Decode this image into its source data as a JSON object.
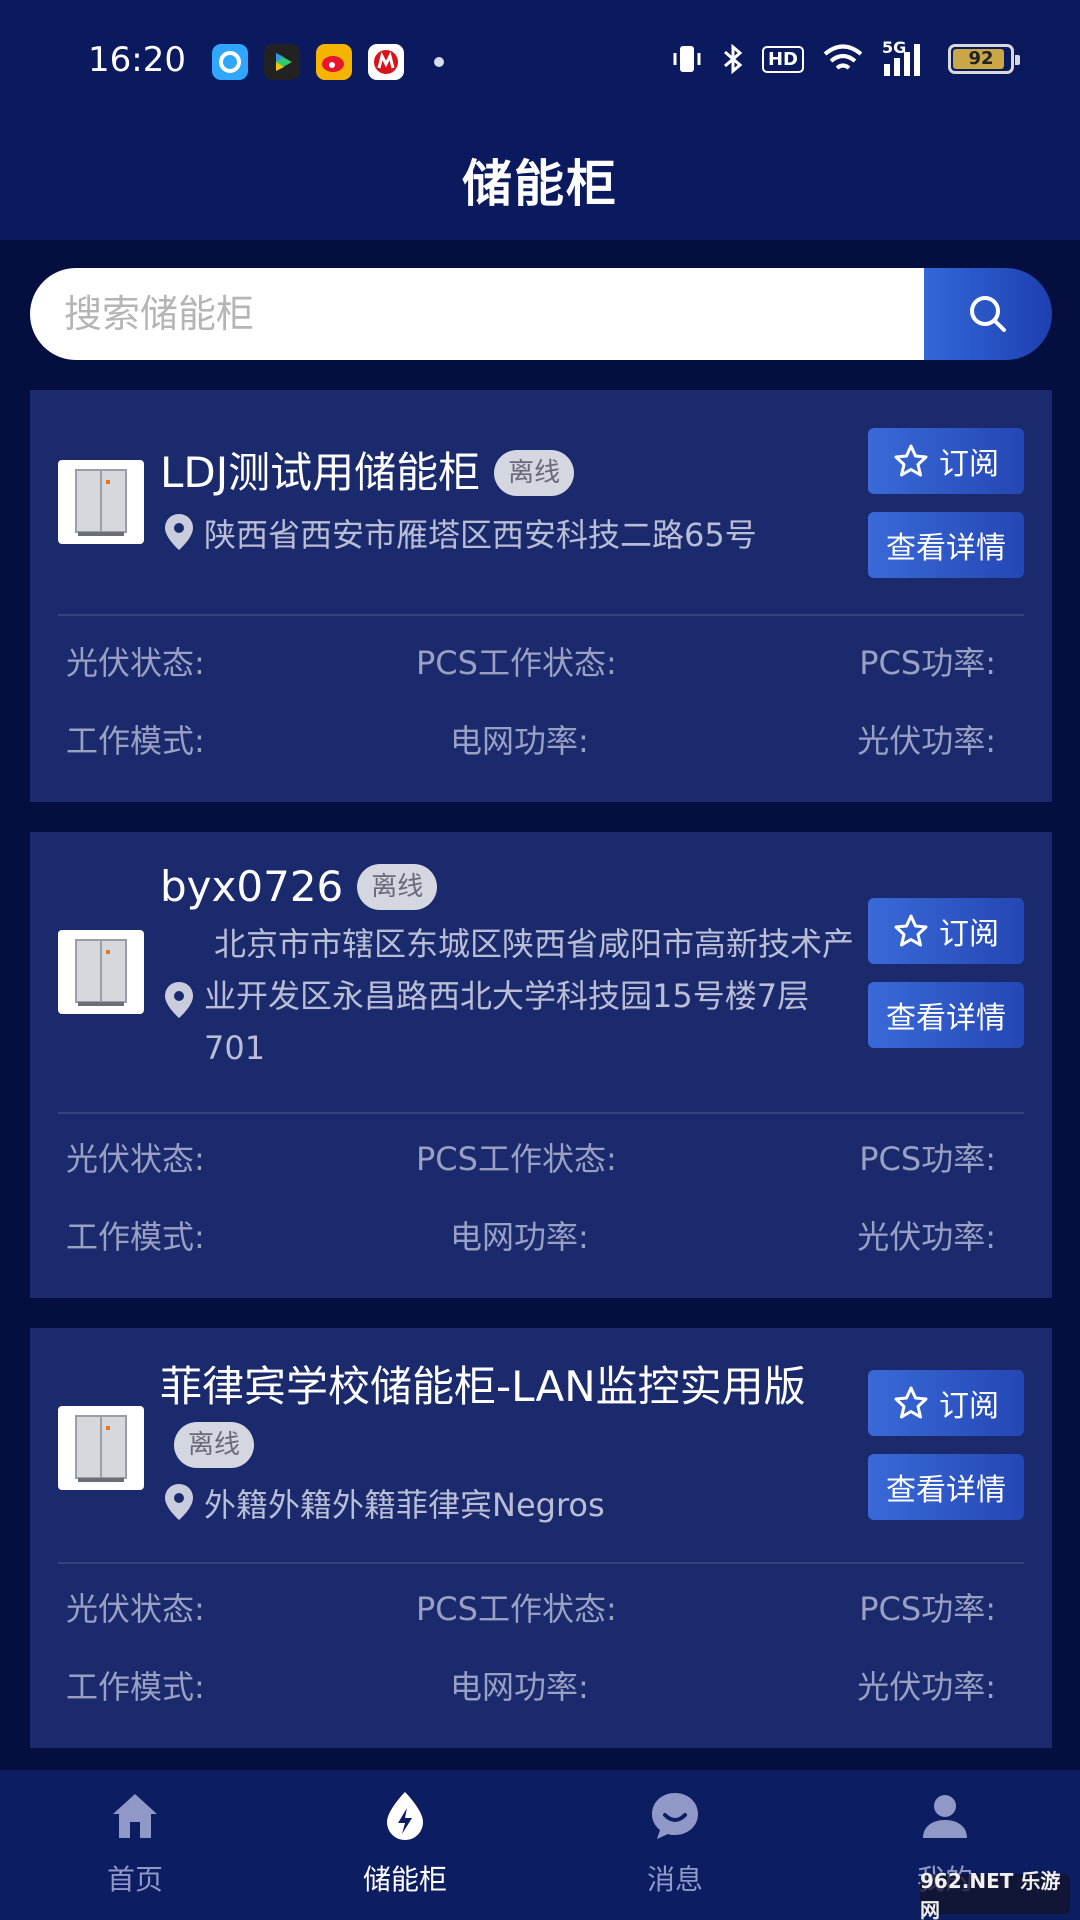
{
  "status_bar": {
    "time": "16:20",
    "apps": [
      "qq-browser-icon",
      "video-icon",
      "weibo-icon",
      "bank-icon"
    ],
    "network": "5G",
    "battery": "92",
    "battery_level": 0.92
  },
  "header": {
    "title": "储能柜"
  },
  "search": {
    "placeholder": "搜索储能柜"
  },
  "cards": [
    {
      "name": "LDJ测试用储能柜",
      "status": "离线",
      "address": "陕西省西安市雁塔区西安科技二路65号",
      "subscribe_label": "订阅",
      "detail_label": "查看详情",
      "stats": {
        "pv_status": "光伏状态:",
        "pcs_status": "PCS工作状态:",
        "pcs_power": "PCS功率:",
        "work_mode": "工作模式:",
        "grid_power": "电网功率:",
        "pv_power": "光伏功率:"
      }
    },
    {
      "name": "byx0726",
      "status": "离线",
      "address": "北京市市辖区东城区陕西省咸阳市高新技术产业开发区永昌路西北大学科技园15号楼7层701",
      "subscribe_label": "订阅",
      "detail_label": "查看详情",
      "stats": {
        "pv_status": "光伏状态:",
        "pcs_status": "PCS工作状态:",
        "pcs_power": "PCS功率:",
        "work_mode": "工作模式:",
        "grid_power": "电网功率:",
        "pv_power": "光伏功率:"
      }
    },
    {
      "name": "菲律宾学校储能柜-LAN监控实用版",
      "status": "离线",
      "address": "外籍外籍外籍菲律宾Negros",
      "subscribe_label": "订阅",
      "detail_label": "查看详情",
      "stats": {
        "pv_status": "光伏状态:",
        "pcs_status": "PCS工作状态:",
        "pcs_power": "PCS功率:",
        "work_mode": "工作模式:",
        "grid_power": "电网功率:",
        "pv_power": "光伏功率:"
      }
    }
  ],
  "bottom_nav": {
    "items": [
      {
        "label": "首页",
        "icon": "home-icon"
      },
      {
        "label": "储能柜",
        "icon": "energy-icon",
        "active": true
      },
      {
        "label": "消息",
        "icon": "message-icon"
      },
      {
        "label": "我的",
        "icon": "profile-icon"
      }
    ]
  },
  "watermark": {
    "text": "962.NET 乐游网"
  },
  "colors": {
    "background": "#050f3f",
    "header": "#0b1a5e",
    "card": "#1a2a6c",
    "accent": "#2f5cd0",
    "badge": "#d4d6e0"
  }
}
